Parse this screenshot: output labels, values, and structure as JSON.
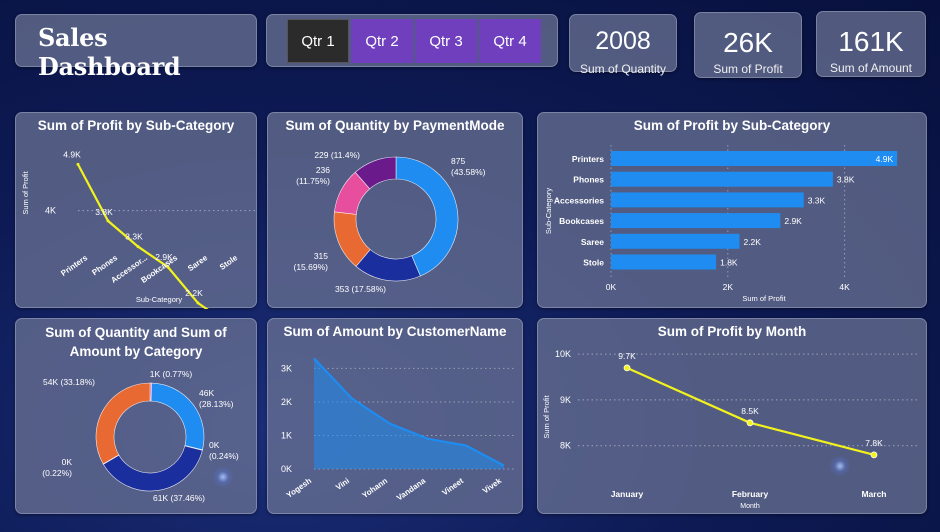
{
  "header": {
    "title": "Sales Dashboard",
    "quarters": [
      "Qtr 1",
      "Qtr 2",
      "Qtr 3",
      "Qtr 4"
    ],
    "selected_quarter": "Qtr 1"
  },
  "kpis": [
    {
      "value": "2008",
      "label": "Sum of Quantity"
    },
    {
      "value": "26K",
      "label": "Sum of Profit"
    },
    {
      "value": "161K",
      "label": "Sum of Amount"
    }
  ],
  "colors": {
    "line_yellow": "#f2f21c",
    "bar_blue": "#1e8cf0",
    "accent_purple": "#6f3fbe",
    "donut_blue": "#1e8cf0",
    "donut_navy": "#1a2e9e",
    "donut_orange": "#e86a32",
    "donut_pink": "#e84e9e",
    "donut_purple": "#6a1a8a"
  },
  "chart_data": [
    {
      "id": "profit_subcat_line",
      "type": "line",
      "title": "Sum of Profit by Sub-Category",
      "xlabel": "Sub-Category",
      "ylabel": "Sum of Profit",
      "categories": [
        "Printers",
        "Phones",
        "Accessor...",
        "Bookcases",
        "Saree",
        "Stole"
      ],
      "values": [
        4900,
        3800,
        3300,
        2900,
        2200,
        1800
      ],
      "data_labels": [
        "4.9K",
        "3.8K",
        "3.3K",
        "2.9K",
        "2.2K",
        "1.8K"
      ],
      "yticks": [
        "4K",
        "2K"
      ],
      "ytick_values": [
        4000,
        2000
      ],
      "ylim": [
        1500,
        5200
      ]
    },
    {
      "id": "quantity_paymentmode_donut",
      "type": "pie",
      "title": "Sum of Quantity by PaymentMode",
      "values": [
        875,
        353,
        315,
        236,
        229
      ],
      "labels": [
        "875 (43.58%)",
        "353 (17.58%)",
        "315 (15.69%)",
        "236 (11.75%)",
        "229 (11.4%)"
      ]
    },
    {
      "id": "profit_subcat_bar",
      "type": "bar",
      "title": "Sum of Profit by Sub-Category",
      "xlabel": "Sum of Profit",
      "ylabel": "Sub-Category",
      "categories": [
        "Printers",
        "Phones",
        "Accessories",
        "Bookcases",
        "Saree",
        "Stole"
      ],
      "values": [
        4900,
        3800,
        3300,
        2900,
        2200,
        1800
      ],
      "data_labels": [
        "4.9K",
        "3.8K",
        "3.3K",
        "2.9K",
        "2.2K",
        "1.8K"
      ],
      "xticks": [
        "0K",
        "2K",
        "4K"
      ],
      "xtick_values": [
        0,
        2000,
        4000
      ],
      "xlim": [
        0,
        5000
      ]
    },
    {
      "id": "qty_amount_category_donut",
      "type": "pie",
      "title": "Sum of Quantity and Sum of Amount by Category",
      "values": [
        770,
        46000,
        240,
        61000,
        220,
        54000
      ],
      "labels": [
        "1K (0.77%)",
        "46K (28.13%)",
        "0K (0.24%)",
        "61K (37.46%)",
        "0K (0.22%)",
        "54K (33.18%)"
      ]
    },
    {
      "id": "amount_customer_area",
      "type": "area",
      "title": "Sum of Amount by CustomerName",
      "categories": [
        "Yogesh",
        "Vini",
        "Yohann",
        "Vandana",
        "Vineet",
        "Vivek"
      ],
      "values": [
        3300,
        2100,
        1350,
        900,
        700,
        100
      ],
      "yticks": [
        "3K",
        "2K",
        "1K",
        "0K"
      ],
      "ytick_values": [
        3000,
        2000,
        1000,
        0
      ],
      "ylim": [
        0,
        3400
      ]
    },
    {
      "id": "profit_month_line",
      "type": "line",
      "title": "Sum of Profit by Month",
      "xlabel": "Month",
      "ylabel": "Sum of Profit",
      "categories": [
        "January",
        "February",
        "March"
      ],
      "values": [
        9700,
        8500,
        7800
      ],
      "data_labels": [
        "9.7K",
        "8.5K",
        "7.8K"
      ],
      "yticks": [
        "10K",
        "9K",
        "8K"
      ],
      "ytick_values": [
        10000,
        9000,
        8000
      ],
      "ylim": [
        7600,
        10200
      ]
    }
  ]
}
